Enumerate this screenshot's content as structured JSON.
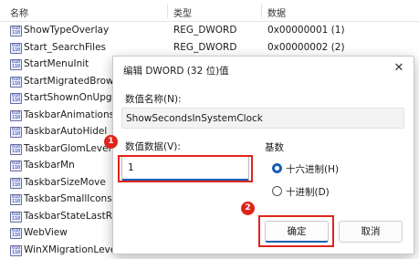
{
  "columns": {
    "name": "名称",
    "type": "类型",
    "data": "数据"
  },
  "icon_glyph": [
    "010",
    "110"
  ],
  "rows": [
    {
      "name": "ShowTypeOverlay",
      "type": "REG_DWORD",
      "data": "0x00000001 (1)"
    },
    {
      "name": "Start_SearchFiles",
      "type": "REG_DWORD",
      "data": "0x00000002 (2)"
    },
    {
      "name": "StartMenuInit",
      "type": "",
      "data": ""
    },
    {
      "name": "StartMigratedBrows",
      "type": "",
      "data": ""
    },
    {
      "name": "StartShownOnUpgr",
      "type": "",
      "data": ""
    },
    {
      "name": "TaskbarAnimations",
      "type": "",
      "data": ""
    },
    {
      "name": "TaskbarAutoHidel",
      "type": "",
      "data": ""
    },
    {
      "name": "TaskbarGlomLevel",
      "type": "",
      "data": ""
    },
    {
      "name": "TaskbarMn",
      "type": "",
      "data": ""
    },
    {
      "name": "TaskbarSizeMove",
      "type": "",
      "data": ""
    },
    {
      "name": "TaskbarSmallIcons",
      "type": "",
      "data": ""
    },
    {
      "name": "TaskbarStateLastRu",
      "type": "",
      "data": ""
    },
    {
      "name": "WebView",
      "type": "",
      "data": ""
    },
    {
      "name": "WinXMigrationLeve",
      "type": "",
      "data": ""
    }
  ],
  "dialog": {
    "title": "编辑 DWORD (32 位)值",
    "close": "✕",
    "name_label": "数值名称(N):",
    "name_value": "ShowSecondsInSystemClock",
    "data_label": "数值数据(V):",
    "data_value": "1",
    "base_label": "基数",
    "hex_label": "十六进制(H)",
    "dec_label": "十进制(D)",
    "base_selected": "hex",
    "ok": "确定",
    "cancel": "取消"
  },
  "badges": {
    "step1": "1",
    "step2": "2"
  },
  "colors": {
    "highlight": "#e0241b",
    "accent": "#1a5fb4"
  }
}
